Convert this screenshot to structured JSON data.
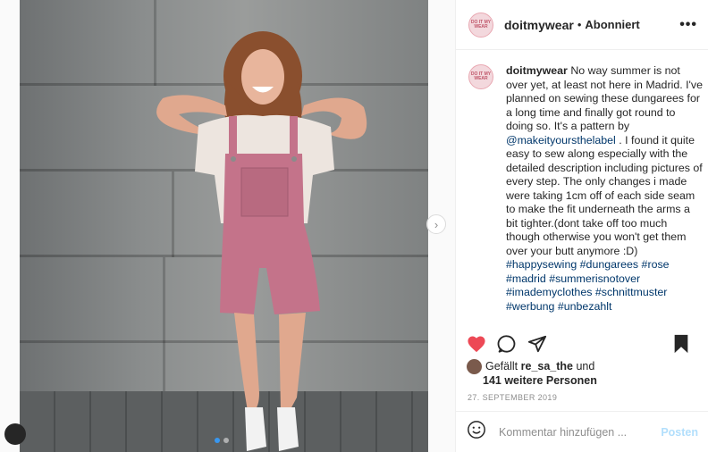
{
  "post": {
    "username": "doitmywear",
    "follow_separator": "•",
    "follow_status": "Abonniert",
    "more_label": "•••",
    "avatar_text": "DO IT MY WEAR",
    "caption": {
      "username": "doitmywear",
      "text_1": "No way summer is not over yet, at least not here in Madrid. I've planned on sewing these dungarees for a long time and finally got round to doing so. It's a pattern by",
      "mention": "@makeityoursthelabel",
      "text_2": ". I found it quite easy to sew along especially with the detailed description including pictures of every step. The only changes i made were taking 1cm off of each side seam to make the fit underneath the arms a bit tighter.(dont take off too much though otherwise you won't get them over your butt anymore :D)",
      "hashtags": "#happysewing #dungarees #rose #madrid #summerisnotover #imademyclothes #schnittmuster #werbung #unbezahlt"
    },
    "likes": {
      "prefix": "Gefällt",
      "user": "re_sa_the",
      "mid": "und",
      "count": "141 weitere Personen"
    },
    "date": "27. SEPTEMBER 2019",
    "comment": {
      "placeholder": "Kommentar hinzufügen ...",
      "post_label": "Posten"
    },
    "carousel": {
      "count": 2,
      "active": 0
    }
  },
  "icons": {
    "like": "heart-filled-icon",
    "comment": "comment-icon",
    "share": "paper-plane-icon",
    "save": "bookmark-icon",
    "emoji": "smiley-icon",
    "next": "chevron-right-icon",
    "profile": "profile-icon"
  },
  "colors": {
    "heart": "#ed4956",
    "link": "#00376b",
    "post_disabled": "#b2dffc",
    "overalls": "#c4738a"
  }
}
